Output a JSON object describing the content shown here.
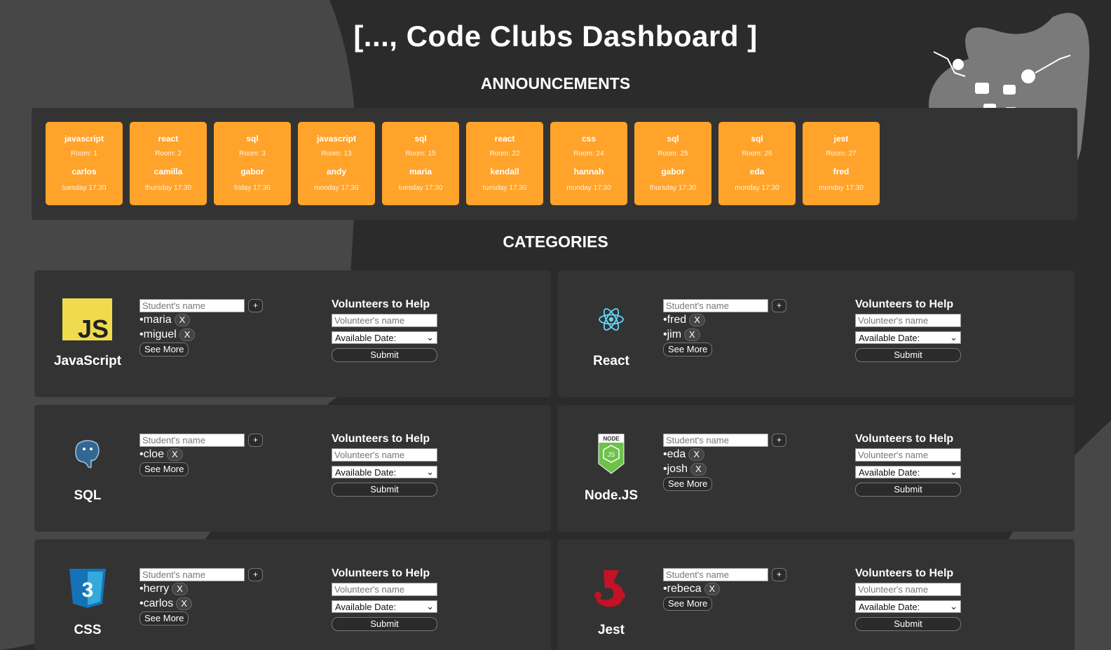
{
  "header": {
    "title": "[..., Code Clubs Dashboard ]"
  },
  "announcements": {
    "heading": "ANNOUNCEMENTS",
    "items": [
      {
        "language": "javascript",
        "room": "Room: 1",
        "host": "carlos",
        "time": "tuesday 17:30"
      },
      {
        "language": "react",
        "room": "Room: 2",
        "host": "camilla",
        "time": "thursday 17:30"
      },
      {
        "language": "sql",
        "room": "Room: 3",
        "host": "gabor",
        "time": "friday 17:30"
      },
      {
        "language": "javascript",
        "room": "Room: 13",
        "host": "andy",
        "time": "monday 17:30"
      },
      {
        "language": "sql",
        "room": "Room: 15",
        "host": "maria",
        "time": "tuesday 17:30"
      },
      {
        "language": "react",
        "room": "Room: 22",
        "host": "kendall",
        "time": "tuesday 17:30"
      },
      {
        "language": "css",
        "room": "Room: 24",
        "host": "hannah",
        "time": "monday 17:30"
      },
      {
        "language": "sql",
        "room": "Room: 25",
        "host": "gabor",
        "time": "thursday 17:30"
      },
      {
        "language": "sql",
        "room": "Room: 26",
        "host": "eda",
        "time": "monday 17:30"
      },
      {
        "language": "jest",
        "room": "Room: 27",
        "host": "fred",
        "time": "monday 17:30"
      }
    ]
  },
  "categories": {
    "heading": "CATEGORIES",
    "common": {
      "student_placeholder": "Student's name",
      "add_label": "+",
      "remove_label": "X",
      "see_more_label": "See More",
      "volunteers_title": "Volunteers to Help",
      "volunteer_placeholder": "Volunteer's name",
      "date_select_value": "Available Date:",
      "submit_label": "Submit"
    },
    "items": [
      {
        "name": "JavaScript",
        "icon": "javascript-logo",
        "students": [
          "maria",
          "miguel"
        ]
      },
      {
        "name": "React",
        "icon": "react-logo",
        "students": [
          "fred",
          "jim"
        ]
      },
      {
        "name": "SQL",
        "icon": "postgresql-logo",
        "students": [
          "cloe"
        ]
      },
      {
        "name": "Node.JS",
        "icon": "nodejs-logo",
        "students": [
          "eda",
          "josh"
        ]
      },
      {
        "name": "CSS",
        "icon": "css3-logo",
        "students": [
          "herry",
          "carlos"
        ]
      },
      {
        "name": "Jest",
        "icon": "jest-logo",
        "students": [
          "rebeca"
        ]
      }
    ]
  },
  "colors": {
    "background": "#2b2b2b",
    "panel": "#333333",
    "accent": "#ffa32a",
    "blob": "#474747"
  }
}
